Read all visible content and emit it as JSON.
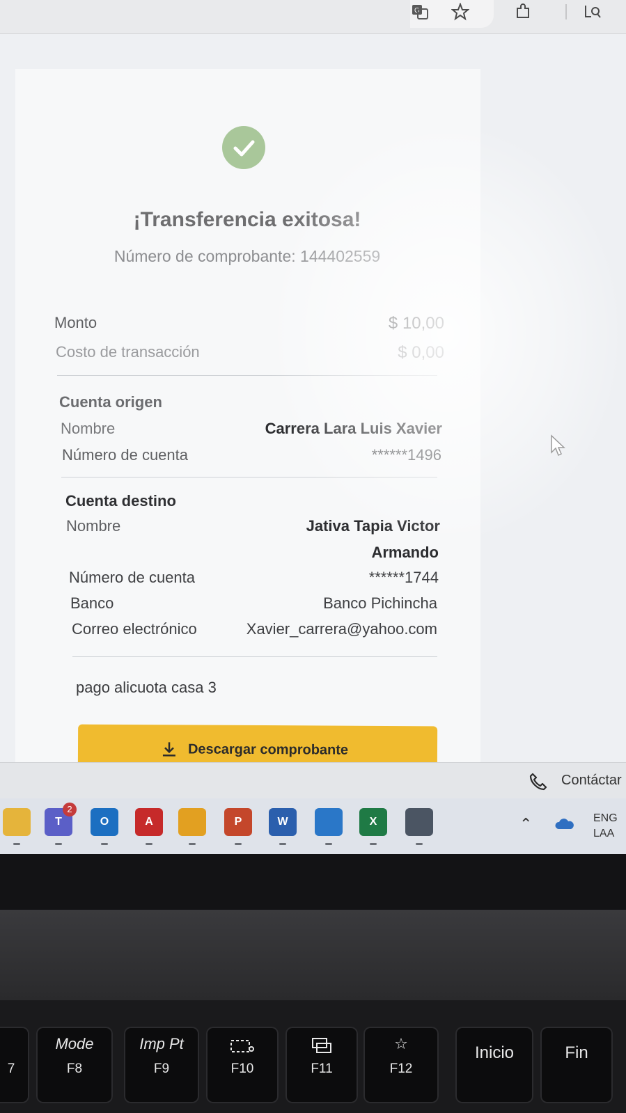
{
  "browser": {
    "icons": [
      "translate-icon",
      "star-icon",
      "extensions-icon",
      "search-icon"
    ]
  },
  "receipt": {
    "title": "¡Transferencia exitosa!",
    "voucher_line": "Número de comprobante: 144402559",
    "amount_label": "Monto",
    "amount_value": "$ 10,00",
    "fee_label": "Costo de transacción",
    "fee_value": "$ 0,00",
    "origin": {
      "section": "Cuenta origen",
      "name_label": "Nombre",
      "name_value": "Carrera Lara Luis Xavier",
      "account_label": "Número de cuenta",
      "account_value": "******1496"
    },
    "destination": {
      "section": "Cuenta destino",
      "name_label": "Nombre",
      "name_line1": "Jativa Tapia Victor",
      "name_line2": "Armando",
      "account_label": "Número de cuenta",
      "account_value": "******1744",
      "bank_label": "Banco",
      "bank_value": "Banco Pichincha",
      "email_label": "Correo electrónico",
      "email_value": "Xavier_carrera@yahoo.com"
    },
    "description": "pago alicuota casa 3",
    "download_label": "Descargar comprobante",
    "accent_color": "#f0bb2f",
    "success_color": "#a9c79a"
  },
  "contact": {
    "label": "Contáctar"
  },
  "taskbar": {
    "apps": [
      {
        "name": "file-explorer",
        "color": "#e5b43b",
        "glyph": ""
      },
      {
        "name": "teams",
        "color": "#5b5fc7",
        "glyph": "T",
        "badge": "2"
      },
      {
        "name": "outlook",
        "color": "#1c6fc1",
        "glyph": "O"
      },
      {
        "name": "acrobat",
        "color": "#c62a2a",
        "glyph": "A"
      },
      {
        "name": "chrome",
        "color": "#e2a021",
        "glyph": ""
      },
      {
        "name": "powerpoint",
        "color": "#c4472b",
        "glyph": "P"
      },
      {
        "name": "word",
        "color": "#2b5fad",
        "glyph": "W"
      },
      {
        "name": "paint",
        "color": "#2a77c8",
        "glyph": ""
      },
      {
        "name": "excel",
        "color": "#1f7a45",
        "glyph": "X"
      },
      {
        "name": "calculator",
        "color": "#4b5563",
        "glyph": ""
      }
    ],
    "lang_line1": "ENG",
    "lang_line2": "LAA"
  },
  "keyboard": {
    "keys": [
      {
        "top": "",
        "bottom": "7"
      },
      {
        "top": "Mode",
        "bottom": "F8"
      },
      {
        "top": "Imp Pt",
        "bottom": "F9"
      },
      {
        "top": "",
        "bottom": "F10"
      },
      {
        "top": "",
        "bottom": "F11"
      },
      {
        "top": "☆",
        "bottom": "F12"
      },
      {
        "top": "Inicio",
        "bottom": ""
      },
      {
        "top": "Fin",
        "bottom": ""
      }
    ]
  }
}
